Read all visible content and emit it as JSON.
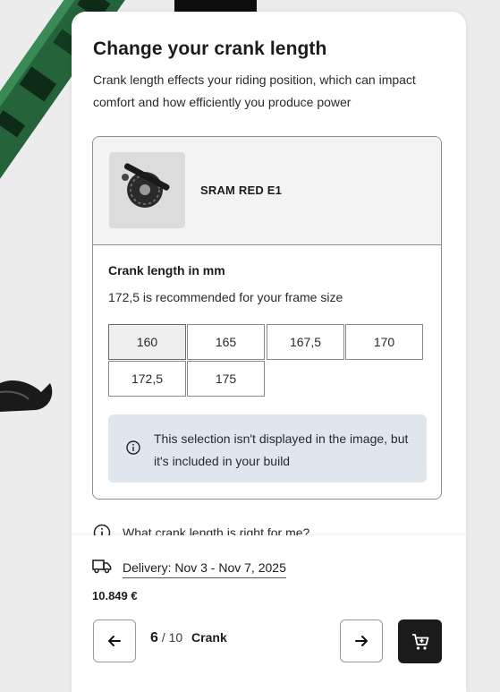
{
  "header": {
    "title": "Change your crank length",
    "subtitle": "Crank length effects your riding position, which can impact comfort and how efficiently you produce power"
  },
  "product": {
    "name": "SRAM RED E1"
  },
  "crank_section": {
    "label": "Crank length in mm",
    "recommendation": "172,5 is recommended for your frame size",
    "options": [
      {
        "label": "160",
        "selected": true
      },
      {
        "label": "165",
        "selected": false
      },
      {
        "label": "167,5",
        "selected": false
      },
      {
        "label": "170",
        "selected": false
      },
      {
        "label": "172,5",
        "selected": false
      },
      {
        "label": "175",
        "selected": false
      }
    ]
  },
  "notice": {
    "text": "This selection isn't displayed in the image, but it's included in your build"
  },
  "help": {
    "text": "What crank length is right for me?"
  },
  "footer": {
    "delivery": "Delivery: Nov 3 - Nov 7, 2025",
    "price": "10.849 €",
    "step_current": "6",
    "step_total": "/ 10",
    "step_name": "Crank"
  },
  "colors": {
    "accent": "#1b1b1b",
    "notice_bg": "#dfe6ec",
    "bike_green": "#2e7a4a"
  },
  "icons": {
    "info": "info-icon",
    "truck": "truck-icon",
    "prev": "arrow-left-icon",
    "next": "arrow-right-icon",
    "cart": "cart-icon"
  }
}
